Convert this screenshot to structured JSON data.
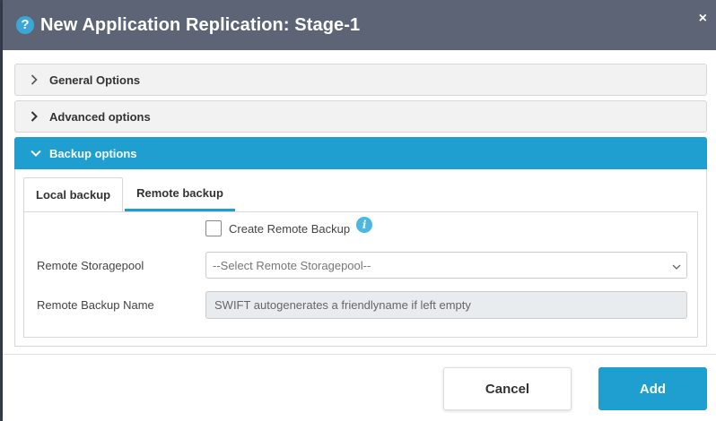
{
  "modal": {
    "title": "New Application Replication: Stage-1",
    "help_icon_glyph": "?",
    "close_glyph": "×"
  },
  "accordion": {
    "general_options": "General Options",
    "advanced_options": "Advanced options",
    "backup_options": "Backup options"
  },
  "tabs": {
    "local_backup": "Local backup",
    "remote_backup": "Remote backup",
    "active": "Remote backup"
  },
  "remote_backup": {
    "create_checkbox_label": "Create Remote Backup",
    "create_checked": false,
    "info_glyph": "i",
    "storagepool_label": "Remote Storagepool",
    "storagepool_selected": "--Select Remote Storagepool--",
    "name_label": "Remote Backup Name",
    "name_value": "",
    "name_placeholder": "SWIFT autogenerates a friendlyname if left empty"
  },
  "footer": {
    "cancel_label": "Cancel",
    "add_label": "Add"
  },
  "colors": {
    "header_bg": "#5c6476",
    "accent": "#1e9fd0"
  },
  "icons": [
    "help-icon",
    "close-icon",
    "chevron-right-icon",
    "chevron-down-icon",
    "info-icon",
    "caret-down-icon"
  ]
}
